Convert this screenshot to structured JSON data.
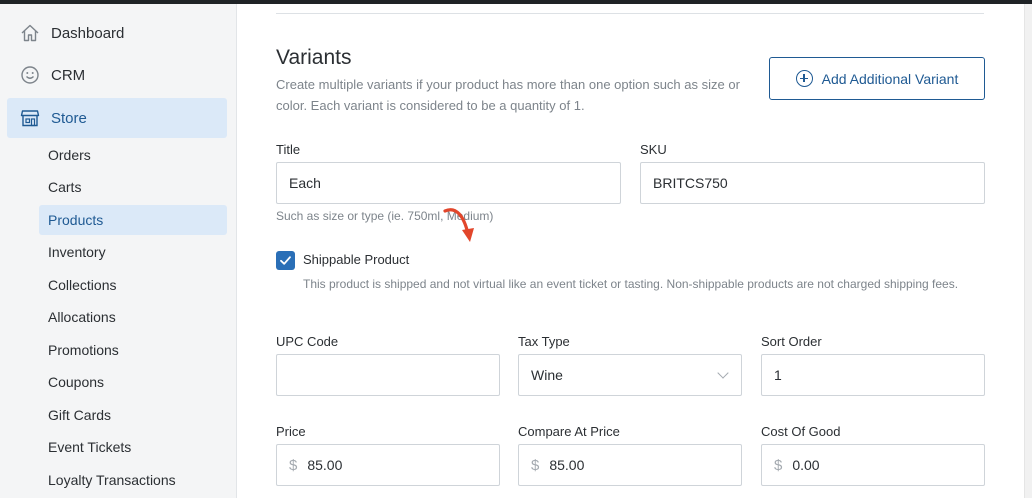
{
  "sidebar": {
    "top_items": [
      {
        "label": "Dashboard",
        "icon": "home-icon"
      },
      {
        "label": "CRM",
        "icon": "smiley-icon"
      },
      {
        "label": "Store",
        "icon": "store-icon",
        "active": true
      }
    ],
    "sub_items": [
      {
        "label": "Orders"
      },
      {
        "label": "Carts"
      },
      {
        "label": "Products",
        "active": true
      },
      {
        "label": "Inventory"
      },
      {
        "label": "Collections"
      },
      {
        "label": "Allocations"
      },
      {
        "label": "Promotions"
      },
      {
        "label": "Coupons"
      },
      {
        "label": "Gift Cards"
      },
      {
        "label": "Event Tickets"
      },
      {
        "label": "Loyalty Transactions"
      }
    ]
  },
  "variants": {
    "heading": "Variants",
    "description": "Create multiple variants if your product has more than one option such as size or color. Each variant is considered to be a quantity of 1.",
    "add_button": "Add Additional Variant"
  },
  "form": {
    "title_label": "Title",
    "title_value": "Each",
    "title_help": "Such as size or type (ie. 750ml, Medium)",
    "sku_label": "SKU",
    "sku_value": "BRITCS750",
    "shippable_label": "Shippable Product",
    "shippable_checked": true,
    "shippable_help": "This product is shipped and not virtual like an event ticket or tasting. Non-shippable products are not charged shipping fees.",
    "upc_label": "UPC Code",
    "upc_value": "",
    "tax_label": "Tax Type",
    "tax_value": "Wine",
    "sort_label": "Sort Order",
    "sort_value": "1",
    "price_label": "Price",
    "price_value": "85.00",
    "compare_label": "Compare At Price",
    "compare_value": "85.00",
    "cost_label": "Cost Of Good",
    "cost_value": "0.00",
    "currency_symbol": "$"
  },
  "colors": {
    "accent": "#1f5a93",
    "active_bg": "#dbe9f8",
    "checkbox": "#2a6fb7",
    "annotation_arrow": "#e2462b"
  }
}
